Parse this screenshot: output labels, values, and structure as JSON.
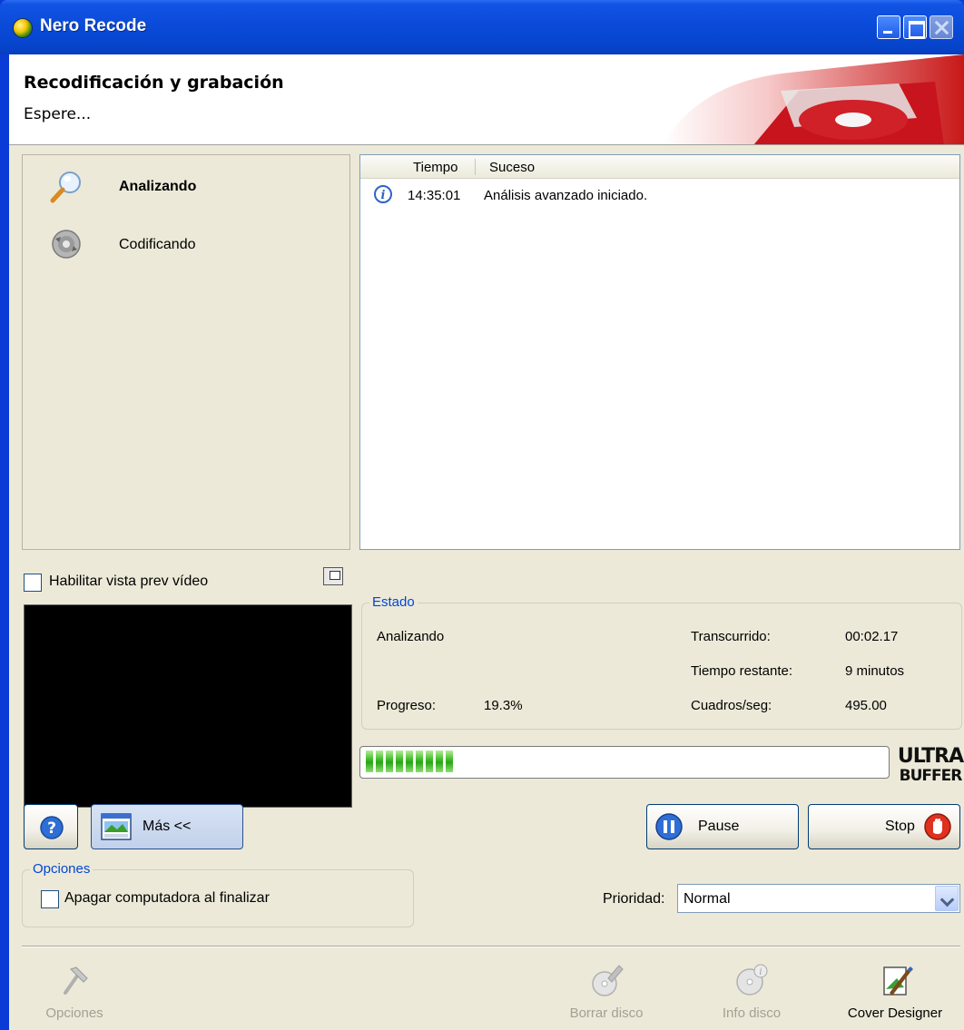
{
  "window": {
    "title": "Nero Recode"
  },
  "header": {
    "title": "Recodificación y grabación",
    "subtitle": "Espere..."
  },
  "steps": [
    {
      "label": "Analizando",
      "icon": "magnifier-icon",
      "active": true
    },
    {
      "label": "Codificando",
      "icon": "encode-disc-icon",
      "active": false
    }
  ],
  "log": {
    "columns": [
      "Tiempo",
      "Suceso"
    ],
    "rows": [
      {
        "icon": "info-icon",
        "time": "14:35:01",
        "event": "Análisis avanzado iniciado."
      }
    ]
  },
  "preview": {
    "checkbox_label": "Habilitar vista prev vídeo",
    "checked": false
  },
  "estado": {
    "legend": "Estado",
    "status": "Analizando",
    "progress_label": "Progreso:",
    "progress_value": "19.3%",
    "elapsed_label": "Transcurrido:",
    "elapsed_value": "00:02.17",
    "remaining_label": "Tiempo restante:",
    "remaining_value": "9 minutos",
    "fps_label": "Cuadros/seg:",
    "fps_value": "495.00"
  },
  "progress_bar": {
    "fraction": 0.193,
    "segments": 9
  },
  "ultrabuffer": {
    "line1": "ULTRA",
    "line2": "BUFFER"
  },
  "buttons": {
    "more": "Más <<",
    "pause": "Pause",
    "stop": "Stop"
  },
  "options": {
    "legend": "Opciones",
    "shutdown_label": "Apagar computadora al finalizar",
    "shutdown_checked": false
  },
  "priority": {
    "label": "Prioridad:",
    "value": "Normal"
  },
  "toolbar": [
    {
      "label": "Opciones",
      "icon": "hammer-icon",
      "enabled": false
    },
    {
      "label": "Borrar disco",
      "icon": "erase-disc-icon",
      "enabled": false
    },
    {
      "label": "Info disco",
      "icon": "disc-info-icon",
      "enabled": false
    },
    {
      "label": "Cover Designer",
      "icon": "cover-designer-icon",
      "enabled": true
    }
  ],
  "colors": {
    "titlebar": "#0a4ad8",
    "legend": "#0046d5",
    "progress": "#2aa51a",
    "window_bg": "#ece9d8"
  }
}
